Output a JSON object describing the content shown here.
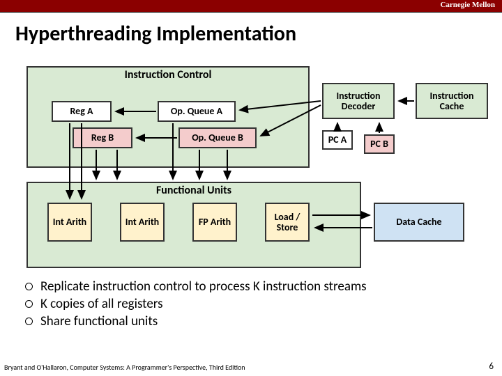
{
  "header": {
    "brand": "Carnegie Mellon"
  },
  "title": "Hyperthreading Implementation",
  "diagram": {
    "instr_control_label": "Instruction Control",
    "reg_a": "Reg A",
    "reg_b": "Reg B",
    "opq_a": "Op. Queue A",
    "opq_b": "Op. Queue B",
    "decoder": "Instruction Decoder",
    "icache": "Instruction Cache",
    "pc_a": "PC A",
    "pc_b": "PC B",
    "func_units_label": "Functional Units",
    "fu1": "Int Arith",
    "fu2": "Int Arith",
    "fu3": "FP Arith",
    "fu4": "Load / Store",
    "dcache": "Data Cache"
  },
  "bullets": {
    "items": [
      "Replicate instruction control to process K instruction streams",
      "K copies of all registers",
      "Share functional units"
    ]
  },
  "footer": {
    "citation": "Bryant and O'Hallaron, Computer Systems: A Programmer's Perspective, Third Edition",
    "page": "6"
  }
}
